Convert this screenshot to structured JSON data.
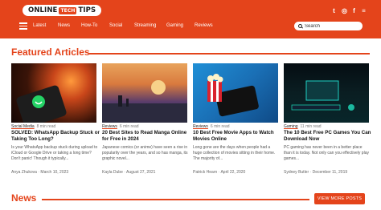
{
  "site": {
    "logo_left": "ONLINE",
    "logo_mid": "TECH",
    "logo_right": "TIPS"
  },
  "social": [
    "twitter-icon",
    "instagram-icon",
    "facebook-icon",
    "rss-icon"
  ],
  "social_glyphs": [
    "t",
    "◎",
    "f",
    "≡"
  ],
  "nav": [
    "Latest",
    "News",
    "How-To",
    "Social",
    "Streaming",
    "Gaming",
    "Reviews"
  ],
  "search": {
    "placeholder": "Search"
  },
  "featured": {
    "title": "Featured Articles",
    "cards": [
      {
        "category": "Social Media",
        "read_time": "8 min read",
        "title": "SOLVED: WhatsApp Backup Stuck or Taking Too Long?",
        "excerpt": "Is your WhatsApp backup stuck during upload to iCloud or Google Drive or taking a long time? Don't panic! Though it typically...",
        "author": "Anya Zhukova",
        "date": "March 10, 2023"
      },
      {
        "category": "Reviews",
        "read_time": "6 min read",
        "title": "20 Best Sites to Read Manga Online for Free in 2024",
        "excerpt": "Japanese comics (or anime) have seen a rise in popularity over the years, and so has manga, its graphic novel...",
        "author": "Kayla Dube",
        "date": "August 27, 2021"
      },
      {
        "category": "Reviews",
        "read_time": "6 min read",
        "title": "10 Best Free Movie Apps to Watch Movies Online",
        "excerpt": "Long gone are the days when people had a huge collection of movies sitting in their home. The majority of...",
        "author": "Patrick Hearn",
        "date": "April 22, 2020"
      },
      {
        "category": "Gaming",
        "read_time": "11 min read",
        "title": "The 10 Best Free PC Games You Can Download Now",
        "excerpt": "PC gaming has never been in a better place than it is today. Not only can you effectively play games...",
        "author": "Sydney Butler",
        "date": "December 11, 2019"
      }
    ]
  },
  "news": {
    "title": "News",
    "more_button": "VIEW MORE POSTS"
  },
  "colors": {
    "brand": "#e4441b"
  }
}
